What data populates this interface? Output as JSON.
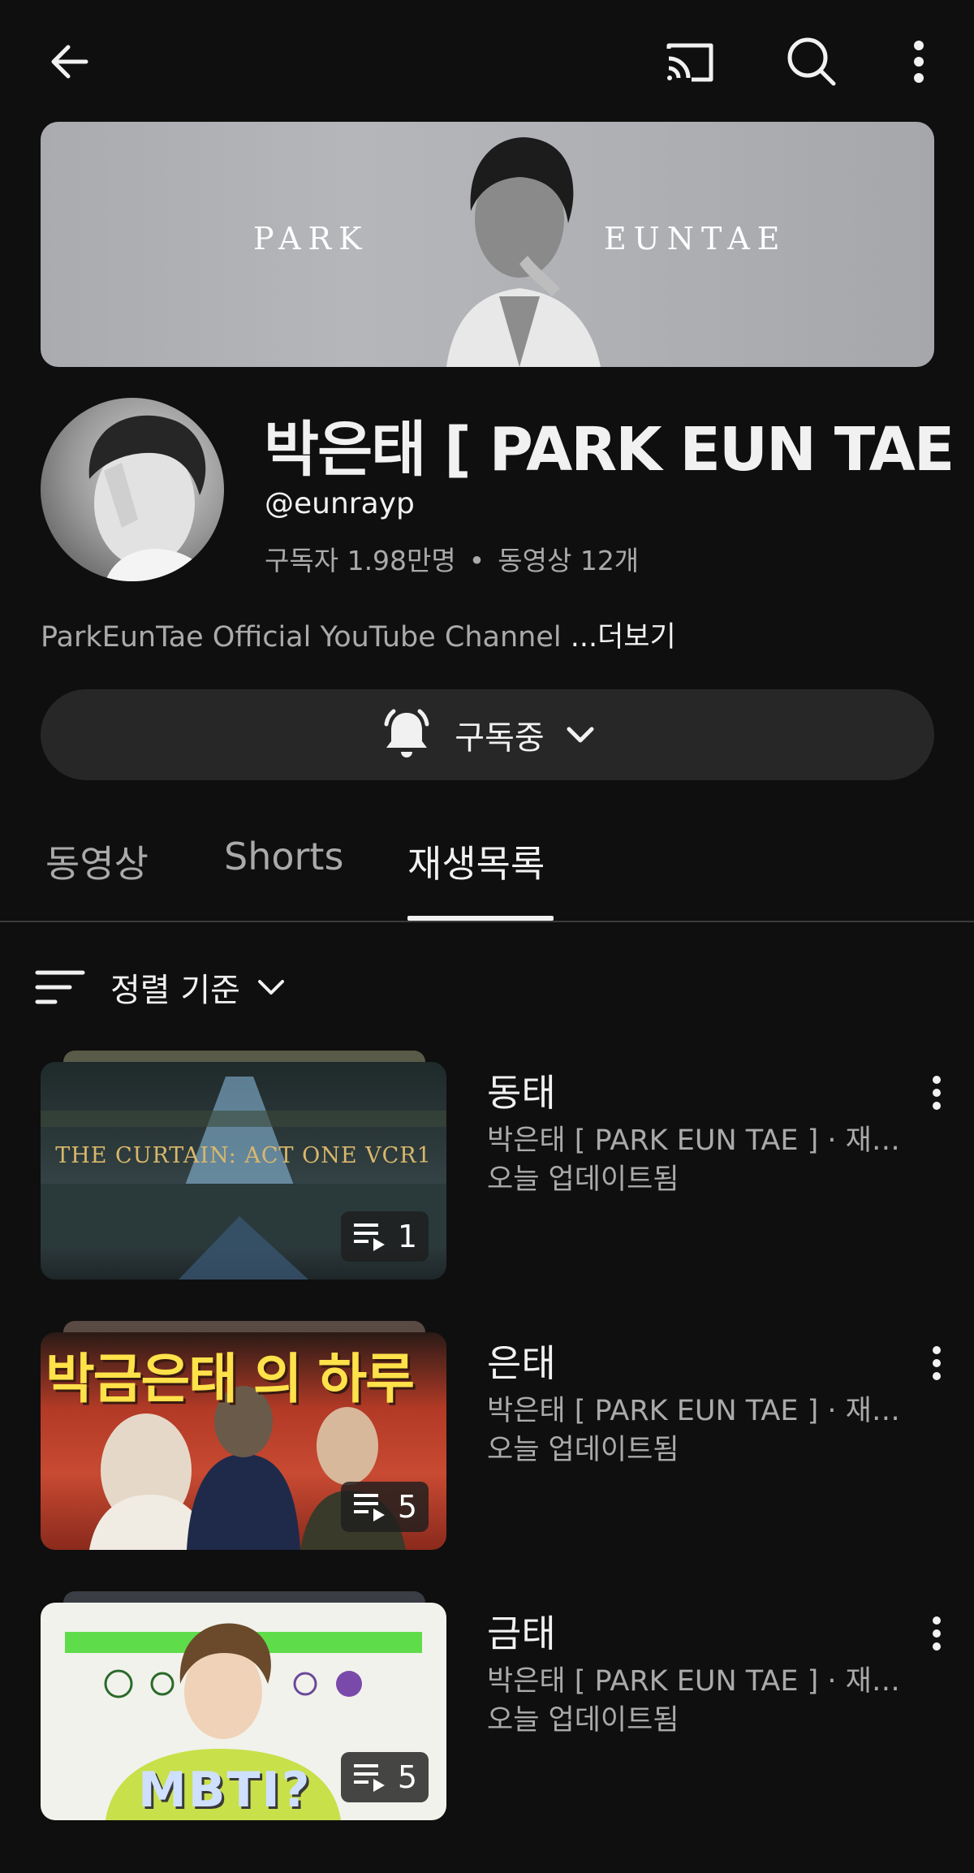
{
  "banner": {
    "word_left": "PARK",
    "word_right": "EUNTAE"
  },
  "channel": {
    "title": "박은태 [ PARK EUN TAE ]",
    "handle": "@eunrayp",
    "subscribers": "구독자 1.98만명",
    "dot": "•",
    "videos": "동영상 12개",
    "description": "ParkEunTae Official YouTube Channel ",
    "more": "...더보기"
  },
  "subscribe": {
    "label": "구독중"
  },
  "tabs": [
    {
      "label": "동영상"
    },
    {
      "label": "Shorts"
    },
    {
      "label": "재생목록",
      "selected": true
    }
  ],
  "sort": {
    "label": "정렬 기준"
  },
  "playlists": [
    {
      "title": "동태",
      "subtitle": "박은태 [ PARK EUN TAE ] · 재…",
      "updated": "오늘 업데이트됨",
      "count": "1",
      "thumb_text": "THE CURTAIN: ACT ONE  VCR1"
    },
    {
      "title": "은태",
      "subtitle": "박은태 [ PARK EUN TAE ] · 재…",
      "updated": "오늘 업데이트됨",
      "count": "5",
      "thumb_text": "박금은태 의 하루"
    },
    {
      "title": "금태",
      "subtitle": "박은태 [ PARK EUN TAE ] · 재…",
      "updated": "오늘 업데이트됨",
      "count": "5",
      "thumb_text": "MBTI?"
    }
  ],
  "colors": {
    "background": "#0f0f0f",
    "surface": "#272727",
    "text_secondary": "#aaaaaa"
  }
}
